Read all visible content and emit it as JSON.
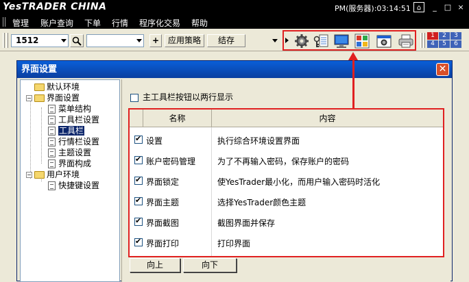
{
  "app": {
    "logo": "YesTRADER CHINA",
    "session_time": "PM(服务器):03:14:51",
    "window_controls": [
      "_",
      "□",
      "×"
    ]
  },
  "menu": [
    "管理",
    "账户查询",
    "下单",
    "行情",
    "程序化交易",
    "帮助"
  ],
  "toolbar": {
    "code_value": "1512",
    "second_combo_value": "",
    "plus_label": "+",
    "apply_strategy_label": "应用策略",
    "save_label": "结存",
    "icons": [
      "settings-gear-icon",
      "password-manager-icon",
      "screen-lock-icon",
      "theme-icon",
      "screenshot-icon",
      "print-icon"
    ],
    "layout_numbers": [
      "1",
      "2",
      "3",
      "4",
      "5",
      "6"
    ]
  },
  "dialog": {
    "title": "界面设置",
    "tree": [
      {
        "label": "默认环境",
        "level": 0,
        "type": "folder"
      },
      {
        "label": "界面设置",
        "level": 0,
        "type": "folder",
        "expanded": true
      },
      {
        "label": "菜单结构",
        "level": 1,
        "type": "doc"
      },
      {
        "label": "工具栏设置",
        "level": 1,
        "type": "doc"
      },
      {
        "label": "工具栏",
        "level": 1,
        "type": "doc",
        "selected": true
      },
      {
        "label": "行情栏设置",
        "level": 1,
        "type": "doc"
      },
      {
        "label": "主题设置",
        "level": 1,
        "type": "doc"
      },
      {
        "label": "界面构成",
        "level": 1,
        "type": "doc"
      },
      {
        "label": "用户环境",
        "level": 0,
        "type": "folder",
        "expanded": true
      },
      {
        "label": "快捷键设置",
        "level": 1,
        "type": "doc"
      }
    ],
    "two_row_option": "主工具栏按钮以两行显示",
    "list": {
      "columns": [
        "名称",
        "内容"
      ],
      "rows": [
        {
          "name": "设置",
          "desc": "执行综合环境设置界面",
          "checked": true
        },
        {
          "name": "账户密码管理",
          "desc": "为了不再输入密码，保存账户的密码",
          "checked": true
        },
        {
          "name": "界面锁定",
          "desc": "使YesTrader最小化，而用户输入密码时活化",
          "checked": true
        },
        {
          "name": "界面主题",
          "desc": "选择YesTrader颜色主题",
          "checked": true
        },
        {
          "name": "界面截图",
          "desc": "截图界面并保存",
          "checked": true
        },
        {
          "name": "界面打印",
          "desc": "打印界面",
          "checked": true
        }
      ]
    },
    "up_label": "向上",
    "down_label": "向下"
  },
  "colors": {
    "highlight": "#e02020",
    "title_blue": "#0a5fd8"
  }
}
